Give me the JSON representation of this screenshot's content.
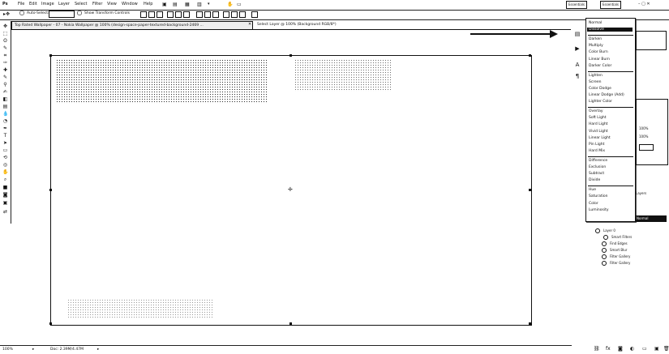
{
  "menubar": {
    "items": [
      "File",
      "Edit",
      "Image",
      "Layer",
      "Select",
      "Filter",
      "View",
      "Window",
      "Help"
    ],
    "workspace_buttons": [
      "Essentials",
      "Essentials"
    ]
  },
  "options": {
    "auto_select_label": "Auto-Select:",
    "auto_select_value": "",
    "show_transform_label": "Show Transform Controls"
  },
  "tabs": [
    {
      "label": "Top Rated Wallpaper - 07 - Nokia Wallpaper @ 100% (design-space-paper-textured-background-2469 ..."
    },
    {
      "label": "Select Layer @ 100% (Background RGB/8*)"
    }
  ],
  "status": {
    "zoom": "100%",
    "doc_info": "Doc: 2.39M/4.47M"
  },
  "blend_menu": {
    "groups": [
      [
        "Normal",
        "Dissolve"
      ],
      [
        "Darken",
        "Multiply",
        "Color Burn",
        "Linear Burn",
        "Darker Color"
      ],
      [
        "Lighten",
        "Screen",
        "Color Dodge",
        "Linear Dodge (Add)",
        "Lighter Color"
      ],
      [
        "Overlay",
        "Soft Light",
        "Hard Light",
        "Vivid Light",
        "Linear Light",
        "Pin Light",
        "Hard Mix"
      ],
      [
        "Difference",
        "Exclusion",
        "Subtract",
        "Divide"
      ],
      [
        "Hue",
        "Saturation",
        "Color",
        "Luminosity"
      ]
    ],
    "highlighted": "Dissolve"
  },
  "layers": {
    "rows": [
      "Layer 0",
      "Smart Filters",
      "Find Edges",
      "Smart Blur",
      "Filter Gallery",
      "Filter Gallery"
    ]
  },
  "right_panel": {
    "opacity_label": "100%",
    "fill_label": "100%",
    "tab_label": "Layers",
    "mode_value": "Normal"
  }
}
